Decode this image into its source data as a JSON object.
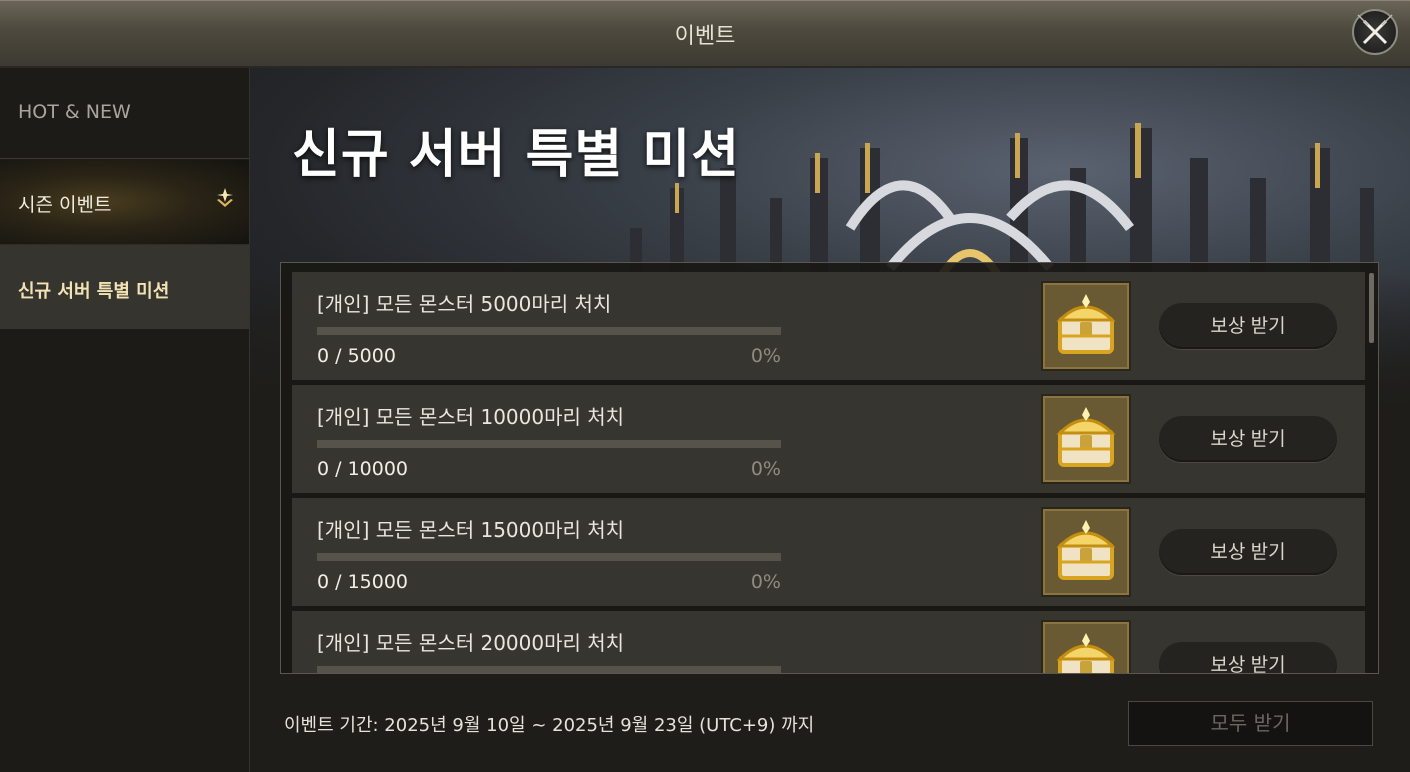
{
  "window": {
    "title": "이벤트"
  },
  "sidebar": {
    "items": [
      {
        "label": "HOT & NEW"
      },
      {
        "label": "시즌 이벤트"
      },
      {
        "label": "신규 서버 특별 미션"
      }
    ]
  },
  "banner": {
    "title": "신규 서버 특별 미션"
  },
  "missions": [
    {
      "title": "[개인] 모든 몬스터 5000마리 처치",
      "count": "0 / 5000",
      "percent": "0%",
      "progress": 0,
      "button": "보상 받기"
    },
    {
      "title": "[개인] 모든 몬스터 10000마리 처치",
      "count": "0 / 10000",
      "percent": "0%",
      "progress": 0,
      "button": "보상 받기"
    },
    {
      "title": "[개인] 모든 몬스터 15000마리 처치",
      "count": "0 / 15000",
      "percent": "0%",
      "progress": 0,
      "button": "보상 받기"
    },
    {
      "title": "[개인] 모든 몬스터 20000마리 처치",
      "count": "",
      "percent": "",
      "progress": 0,
      "button": "보상 받기"
    }
  ],
  "footer": {
    "period": "이벤트 기간: 2025년 9월 10일 ~ 2025년 9월 23일 (UTC+9) 까지",
    "claim_all": "모두 받기"
  },
  "icons": {
    "close": "close-x-icon",
    "season": "diamond-star-icon",
    "reward": "golden-chest-icon"
  },
  "colors": {
    "accent_gold": "#d8b660",
    "selected_label": "#f3e3b4"
  }
}
